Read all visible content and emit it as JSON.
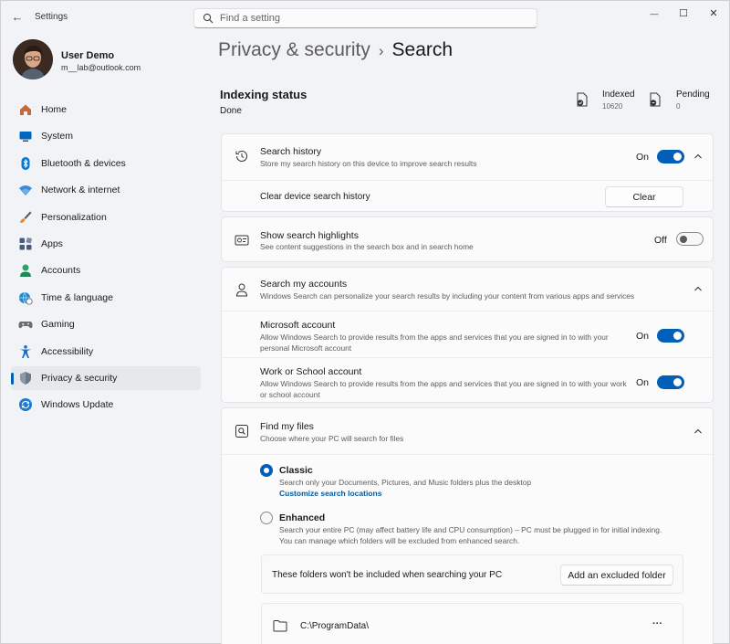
{
  "app": {
    "title": "Settings",
    "back_glyph": "←",
    "search_placeholder": "Find a setting",
    "window_controls": {
      "minimize": "—",
      "maximize": "☐",
      "close": "✕"
    }
  },
  "profile": {
    "name": "User Demo",
    "email": "m__lab@outlook.com"
  },
  "sidebar": {
    "items": [
      {
        "label": "Home",
        "icon": "home-icon",
        "color": "#c7673a"
      },
      {
        "label": "System",
        "icon": "monitor-icon",
        "color": "#0067c0"
      },
      {
        "label": "Bluetooth & devices",
        "icon": "bluetooth-icon",
        "color": "#0078d4"
      },
      {
        "label": "Network & internet",
        "icon": "wifi-icon",
        "color": "#3a8bd8"
      },
      {
        "label": "Personalization",
        "icon": "paintbrush-icon",
        "color": "#e08a3c"
      },
      {
        "label": "Apps",
        "icon": "apps-icon",
        "color": "#4a5a7a"
      },
      {
        "label": "Accounts",
        "icon": "person-icon",
        "color": "#2aa36b"
      },
      {
        "label": "Time & language",
        "icon": "globe-clock-icon",
        "color": "#1a8ad4"
      },
      {
        "label": "Gaming",
        "icon": "gamepad-icon",
        "color": "#6c6c6c"
      },
      {
        "label": "Accessibility",
        "icon": "accessibility-icon",
        "color": "#1a6fc7"
      },
      {
        "label": "Privacy & security",
        "icon": "shield-icon",
        "color": "#6b7a8a",
        "active": true
      },
      {
        "label": "Windows Update",
        "icon": "update-icon",
        "color": "#1a7ad4"
      }
    ]
  },
  "header": {
    "breadcrumb": "Privacy & security",
    "separator": "›",
    "title": "Search"
  },
  "indexing": {
    "title": "Indexing status",
    "status": "Done",
    "indexed_label": "Indexed",
    "indexed_value": "10620",
    "pending_label": "Pending",
    "pending_value": "0"
  },
  "search_history": {
    "title": "Search history",
    "desc": "Store my search history on this device to improve search results",
    "state": "On",
    "clear_label": "Clear device search history",
    "clear_button": "Clear"
  },
  "highlights": {
    "title": "Show search highlights",
    "desc": "See content suggestions in the search box and in search home",
    "state": "Off"
  },
  "accounts": {
    "title": "Search my accounts",
    "desc": "Windows Search can personalize your search results by including your content from various apps and services",
    "microsoft": {
      "title": "Microsoft account",
      "desc": "Allow Windows Search to provide results from the apps and services that you are signed in to with your personal Microsoft account",
      "state": "On"
    },
    "work": {
      "title": "Work or School account",
      "desc": "Allow Windows Search to provide results from the apps and services that you are signed in to with your work or school account",
      "state": "On"
    }
  },
  "find_files": {
    "title": "Find my files",
    "desc": "Choose where your PC will search for files",
    "classic": {
      "label": "Classic",
      "desc": "Search only your Documents, Pictures, and Music folders plus the desktop",
      "link": "Customize search locations"
    },
    "enhanced": {
      "label": "Enhanced",
      "desc": "Search your entire PC (may affect battery life and CPU consumption) – PC must be plugged in for initial indexing. You can manage which folders will be excluded from enhanced search."
    },
    "excluded_text": "These folders won't be included when searching your PC",
    "add_excluded_button": "Add an excluded folder",
    "folder_path": "C:\\ProgramData\\",
    "more_glyph": "···"
  },
  "colors": {
    "accent": "#005fb8",
    "window_bg": "#f1f3f6",
    "card_bg": "#fbfbfb"
  }
}
